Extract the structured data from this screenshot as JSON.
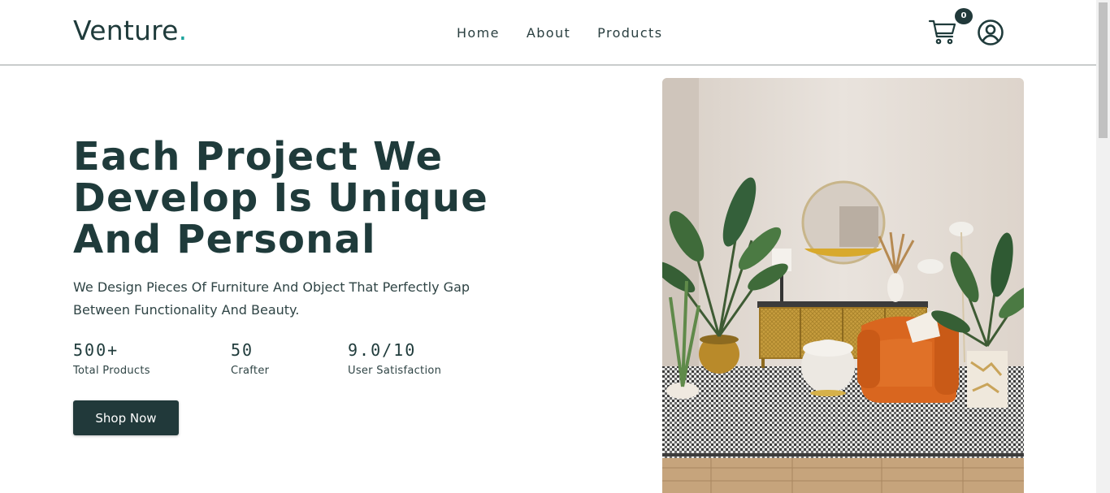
{
  "brand": {
    "name": "Venture",
    "dot": ".",
    "accent_color": "#1ba39c"
  },
  "nav": {
    "links": [
      {
        "label": "Home"
      },
      {
        "label": "About"
      },
      {
        "label": "Products"
      }
    ],
    "cart": {
      "icon": "cart-icon",
      "count": "0"
    },
    "user": {
      "icon": "user-circle-icon"
    }
  },
  "hero": {
    "title_lines": [
      "Each Project We",
      "Develop Is Unique",
      "And Personal"
    ],
    "subtitle": "We Design Pieces Of Furniture And Object That Perfectly Gap Between Functionality And Beauty.",
    "stats": [
      {
        "value": "500+",
        "label": "Total Products"
      },
      {
        "value": "50",
        "label": "Crafter"
      },
      {
        "value": "9.0/10",
        "label": "User Satisfaction"
      }
    ],
    "cta_label": "Shop Now",
    "image": "living-room-furniture-image"
  },
  "colors": {
    "primary": "#21393a",
    "text": "#1f3b3b",
    "accent": "#1ba39c",
    "armchair": "#d9661f"
  }
}
